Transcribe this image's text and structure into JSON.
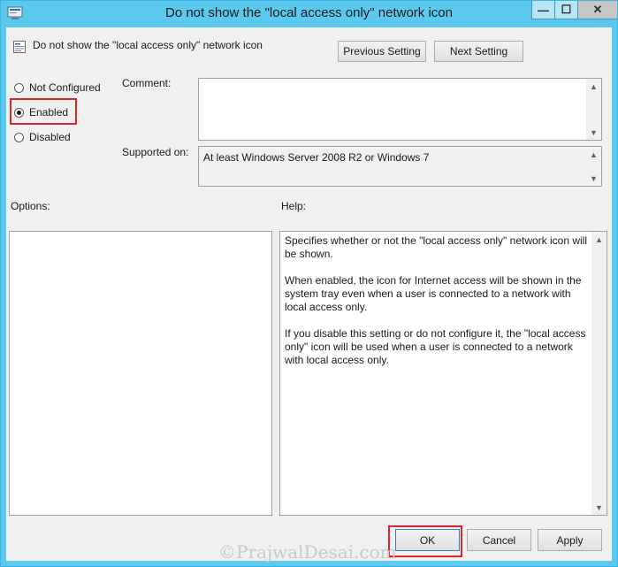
{
  "window": {
    "title": "Do not show the \"local access only\" network icon",
    "minimize": "—",
    "maximize": "☐",
    "close": "✕"
  },
  "policy": {
    "name": "Do not show the \"local access only\" network icon",
    "icon": "policy-icon"
  },
  "nav": {
    "previous": "Previous Setting",
    "next": "Next Setting"
  },
  "state": {
    "options": [
      {
        "label": "Not Configured",
        "selected": false
      },
      {
        "label": "Enabled",
        "selected": true
      },
      {
        "label": "Disabled",
        "selected": false
      }
    ]
  },
  "comment": {
    "label": "Comment:",
    "value": ""
  },
  "supported": {
    "label": "Supported on:",
    "value": "At least Windows Server 2008 R2 or Windows 7"
  },
  "options_panel": {
    "label": "Options:"
  },
  "help": {
    "label": "Help:",
    "paragraphs": [
      "Specifies whether or not the \"local access only\" network icon will be shown.",
      "When enabled, the icon for Internet access will be shown in the system tray even when a user is connected to a network with local access only.",
      "If you disable this setting or do not configure it, the \"local access only\" icon will be used when a user is connected to a network with local access only."
    ]
  },
  "footer": {
    "ok": "OK",
    "cancel": "Cancel",
    "apply": "Apply"
  },
  "watermark": "©PrajwalDesai.com",
  "colors": {
    "titlebar": "#5bc8ed",
    "highlight": "#e0202a",
    "client_bg": "#f0f0f0"
  }
}
